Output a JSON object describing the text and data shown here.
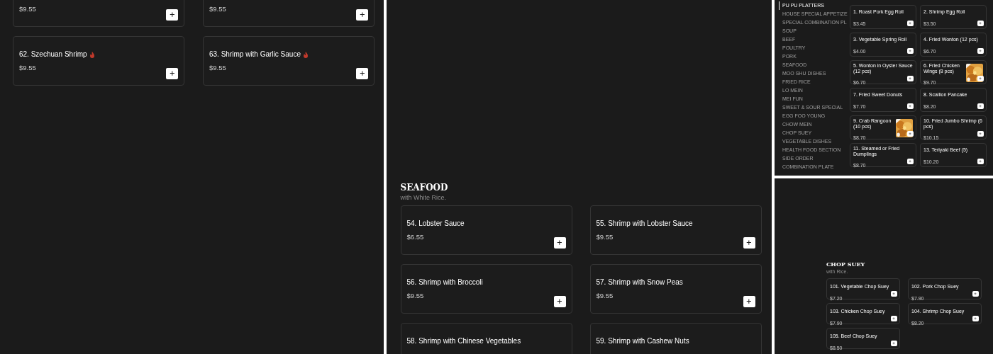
{
  "panels": [
    {
      "kind": "menu",
      "cards": [
        {
          "price": "$9.55",
          "spicy": false,
          "add_button": true
        },
        {
          "price": "$9.55",
          "spicy": false,
          "add_button": true
        },
        {
          "title": "62. Szechuan Shrimp",
          "price": "$9.55",
          "spicy": true,
          "add_button": true
        },
        {
          "title": "63. Shrimp with Garlic Sauce",
          "price": "$9.55",
          "spicy": true,
          "add_button": true
        }
      ]
    },
    {
      "kind": "menu",
      "section": {
        "title": "SEAFOOD",
        "subtitle": "with White Rice."
      },
      "cards": [
        {
          "title": "54. Lobster Sauce",
          "price": "$6.55",
          "spicy": false,
          "add_button": true
        },
        {
          "title": "55. Shrimp with Lobster Sauce",
          "price": "$9.55",
          "spicy": false,
          "add_button": true
        },
        {
          "title": "56. Shrimp with Broccoli",
          "price": "$9.55",
          "spicy": false,
          "add_button": true
        },
        {
          "title": "57. Shrimp with Snow Peas",
          "price": "$9.55",
          "spicy": false,
          "add_button": true
        },
        {
          "title": "58. Shrimp with Chinese Vegetables",
          "spicy": false,
          "add_button": false
        },
        {
          "title": "59. Shrimp with Cashew Nuts",
          "spicy": false,
          "add_button": false
        }
      ]
    },
    {
      "kind": "menu_with_sidebar",
      "sidebar": {
        "items": [
          {
            "label": "PU PU PLATTERS",
            "selected": true
          },
          {
            "label": "HOUSE SPECIAL APPETIZE",
            "selected": false
          },
          {
            "label": "SPECIAL COMBINATION PL",
            "selected": false
          },
          {
            "label": "SOUP",
            "selected": false
          },
          {
            "label": "BEEF",
            "selected": false
          },
          {
            "label": "POULTRY",
            "selected": false
          },
          {
            "label": "PORK",
            "selected": false
          },
          {
            "label": "SEAFOOD",
            "selected": false
          },
          {
            "label": "MOO SHU DISHES",
            "selected": false
          },
          {
            "label": "FRIED RICE",
            "selected": false
          },
          {
            "label": "LO MEIN",
            "selected": false
          },
          {
            "label": "MEI FUN",
            "selected": false
          },
          {
            "label": "SWEET & SOUR SPECIAL",
            "selected": false
          },
          {
            "label": "EGG FOO YOUNG",
            "selected": false
          },
          {
            "label": "CHOW MEIN",
            "selected": false
          },
          {
            "label": "CHOP SUEY",
            "selected": false
          },
          {
            "label": "VEGETABLE DISHES",
            "selected": false
          },
          {
            "label": "HEALTH FOOD SECTION",
            "selected": false
          },
          {
            "label": "SIDE ORDER",
            "selected": false
          },
          {
            "label": "COMBINATION PLATE",
            "selected": false
          }
        ]
      },
      "cards": [
        {
          "title": "1. Roast Pork Egg Roll",
          "price": "$3.45",
          "spicy": false,
          "add_button": true
        },
        {
          "title": "2. Shrimp Egg Roll",
          "price": "$3.50",
          "spicy": false,
          "add_button": true
        },
        {
          "title": "3. Vegetable Spring Roll",
          "price": "$4.00",
          "spicy": false,
          "add_button": true
        },
        {
          "title": "4. Fried Wonton (12 pcs)",
          "price": "$6.70",
          "spicy": false,
          "add_button": true
        },
        {
          "title": "5. Wonton in Oyster Sauce (12 pcs)",
          "price": "$6.70",
          "spicy": false,
          "add_button": true
        },
        {
          "title": "6. Fried Chicken Wings (8 pcs)",
          "price": "$9.70",
          "spicy": false,
          "add_button": true
        },
        {
          "title": "7. Fried Sweet Donuts",
          "price": "$7.70",
          "spicy": false,
          "add_button": true
        },
        {
          "title": "8. Scallion Pancake",
          "price": "$8.20",
          "spicy": false,
          "add_button": true
        },
        {
          "title": "9. Crab Rangoon (10 pcs)",
          "price": "$8.70",
          "spicy": false,
          "add_button": true
        },
        {
          "title": "10. Fried Jumbo Shrimp (6 pcs)",
          "price": "$10.15",
          "spicy": false,
          "add_button": true
        },
        {
          "title": "11. Steamed or Fried Dumplings",
          "price": "$8.70",
          "spicy": false,
          "add_button": true
        },
        {
          "title": "13. Teriyaki Beef (5)",
          "price": "$10.20",
          "spicy": false,
          "add_button": true
        }
      ]
    },
    {
      "kind": "menu",
      "section": {
        "title": "CHOP SUEY",
        "subtitle": "with Rice."
      },
      "cards": [
        {
          "title": "101. Vegetable Chop Suey",
          "price": "$7.20",
          "spicy": false,
          "add_button": true
        },
        {
          "title": "102. Pork Chop Suey",
          "price": "$7.90",
          "spicy": false,
          "add_button": true
        },
        {
          "title": "103. Chicken Chop Suey",
          "price": "$7.90",
          "spicy": false,
          "add_button": true
        },
        {
          "title": "104. Shrimp Chop Suey",
          "price": "$8.20",
          "spicy": false,
          "add_button": true
        },
        {
          "title": "105. Beef Chop Suey",
          "price": "$8.50",
          "spicy": false,
          "add_button": true
        }
      ]
    }
  ]
}
